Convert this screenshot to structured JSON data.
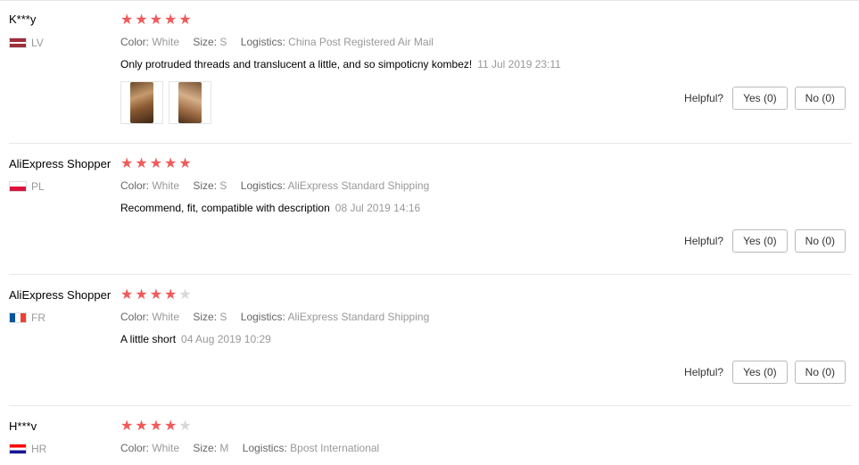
{
  "labels": {
    "color": "Color:",
    "size": "Size:",
    "logistics": "Logistics:",
    "helpful": "Helpful?"
  },
  "reviews": [
    {
      "name": "K***y",
      "country": "LV",
      "rating": 5,
      "color": "White",
      "size": "S",
      "logistics": "China Post Registered Air Mail",
      "text": "Only protruded threads and translucent a little, and so simpoticny kombez!",
      "date": "11 Jul 2019 23:11",
      "yes": "Yes (0)",
      "no": "No (0)"
    },
    {
      "name": "AliExpress Shopper",
      "country": "PL",
      "rating": 5,
      "color": "White",
      "size": "S",
      "logistics": "AliExpress Standard Shipping",
      "text": "Recommend, fit, compatible with description",
      "date": "08 Jul 2019 14:16",
      "yes": "Yes (0)",
      "no": "No (0)"
    },
    {
      "name": "AliExpress Shopper",
      "country": "FR",
      "rating": 4,
      "color": "White",
      "size": "S",
      "logistics": "AliExpress Standard Shipping",
      "text": "A little short",
      "date": "04 Aug 2019 10:29",
      "yes": "Yes (0)",
      "no": "No (0)"
    },
    {
      "name": "H***v",
      "country": "HR",
      "rating": 4,
      "color": "White",
      "size": "M",
      "logistics": "Bpost International"
    }
  ],
  "colors": {
    "star": "#f05a5a",
    "star_empty": "#d8d8d8"
  }
}
